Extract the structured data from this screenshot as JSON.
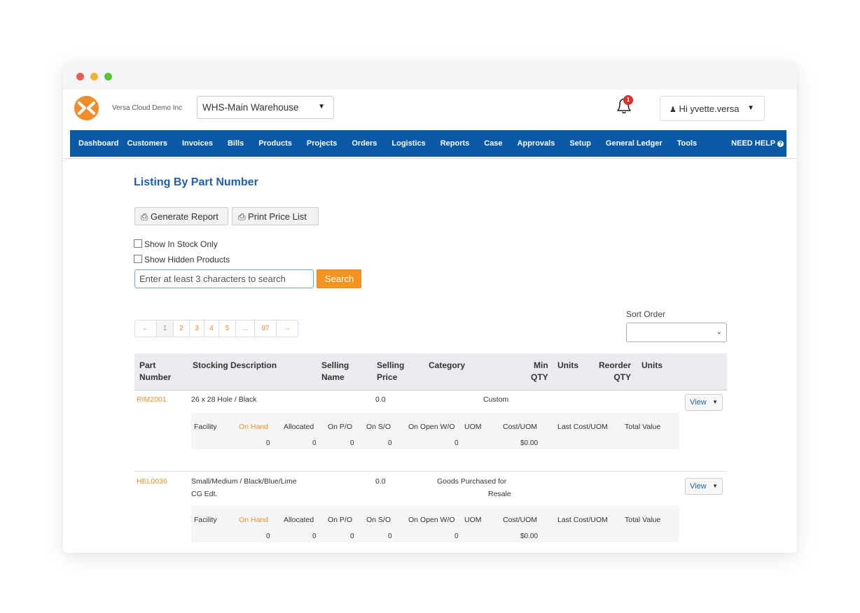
{
  "header": {
    "company": "Versa Cloud Demo Inc",
    "warehouse": "WHS-Main Warehouse",
    "notification_count": "1",
    "user_greeting": "Hi yvette.versa"
  },
  "nav": [
    "Dashboard",
    "Customers",
    "Invoices",
    "Bills",
    "Products",
    "Projects",
    "Orders",
    "Logistics",
    "Reports",
    "Case",
    "Approvals",
    "Setup",
    "General Ledger",
    "Tools",
    "NEED HELP"
  ],
  "page": {
    "title": "Listing By Part Number",
    "generate_report": "Generate Report",
    "print_price_list": "Print Price List",
    "show_in_stock": "Show In Stock Only",
    "show_hidden": "Show Hidden Products",
    "search_placeholder": "Enter at least 3 characters to search",
    "search_button": "Search",
    "sort_label": "Sort Order"
  },
  "pagination": [
    "←",
    "1",
    "2",
    "3",
    "4",
    "5",
    "...",
    "97",
    "→"
  ],
  "table": {
    "headers": {
      "part_number": [
        "Part",
        "Number"
      ],
      "stocking_description": "Stocking Description",
      "selling_name": [
        "Selling",
        "Name"
      ],
      "selling_price": [
        "Selling",
        "Price"
      ],
      "category": "Category",
      "min_qty": [
        "Min",
        "QTY"
      ],
      "units1": "Units",
      "reorder_qty": [
        "Reorder",
        "QTY"
      ],
      "units2": "Units"
    },
    "sub_headers": [
      "Facility",
      "On Hand",
      "Allocated",
      "On P/O",
      "On S/O",
      "On Open W/O",
      "UOM",
      "Cost/UOM",
      "Last Cost/UOM",
      "Total Value"
    ],
    "view_label": "View",
    "rows": [
      {
        "part": "RIM2001",
        "desc": [
          "26 x 28 Hole / Black"
        ],
        "price": "0.0",
        "category": [
          "Custom"
        ],
        "sub_values": {
          "on_hand": "0",
          "allocated": "0",
          "on_po": "0",
          "on_so": "0",
          "on_wo": "0",
          "cost": "$0.00"
        }
      },
      {
        "part": "HEL0036",
        "desc": [
          "Small/Medium / Black/Blue/Lime",
          "CG Edt."
        ],
        "price": "0.0",
        "category": [
          "Goods Purchased for",
          "Resale"
        ],
        "sub_values": {
          "on_hand": "0",
          "allocated": "0",
          "on_po": "0",
          "on_so": "0",
          "on_wo": "0",
          "cost": "$0.00"
        }
      }
    ]
  },
  "colors": {
    "nav_bg": "#0a5aa8",
    "accent": "#f28c28",
    "title": "#1c5faa",
    "search_button": "#f39422"
  }
}
